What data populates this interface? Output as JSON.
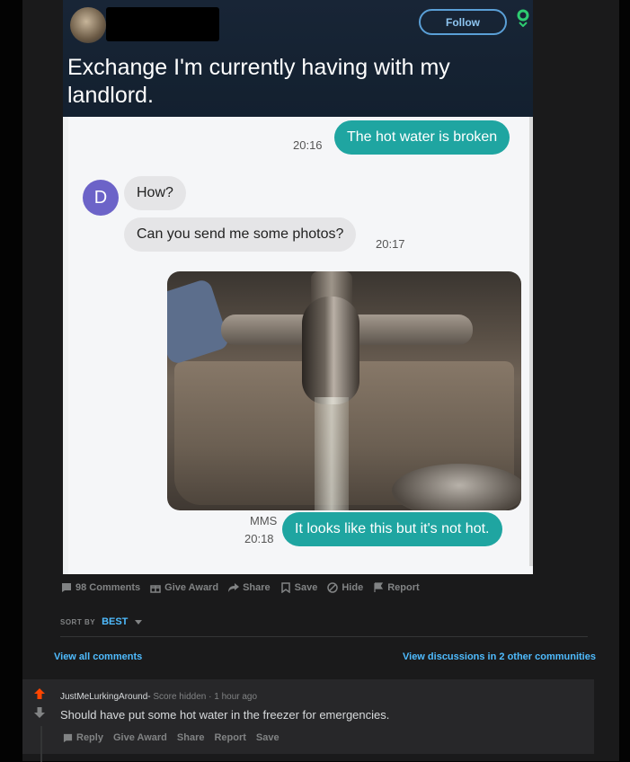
{
  "post_image": {
    "follow_label": "Follow",
    "tweet_text": "Exchange I'm currently having with my landlord.",
    "messages": [
      {
        "text": "The hot water is broken",
        "time": "20:16",
        "side": "out"
      },
      {
        "text": "How?",
        "side": "in"
      },
      {
        "text": "Can you send me some photos?",
        "time": "20:17",
        "side": "in"
      },
      {
        "text": "It looks like this but it's not hot.",
        "time": "20:18",
        "tag": "MMS",
        "side": "out"
      }
    ],
    "sender_initial": "D"
  },
  "actions": {
    "comments": "98 Comments",
    "give_award": "Give Award",
    "share": "Share",
    "save": "Save",
    "hide": "Hide",
    "report": "Report"
  },
  "sort": {
    "label": "SORT BY",
    "value": "BEST"
  },
  "links": {
    "view_all": "View all comments",
    "discussions": "View discussions in 2 other communities"
  },
  "comment": {
    "author": "JustMeLurkingAround-",
    "score": "Score hidden",
    "time": "1 hour ago",
    "body": "Should have put some hot water in the freezer for emergencies.",
    "actions": {
      "reply": "Reply",
      "give_award": "Give Award",
      "share": "Share",
      "report": "Report",
      "save": "Save"
    }
  },
  "colors": {
    "upvote": "#ff4500",
    "link": "#4fbcff",
    "bubble_out": "#1fa5a1"
  }
}
